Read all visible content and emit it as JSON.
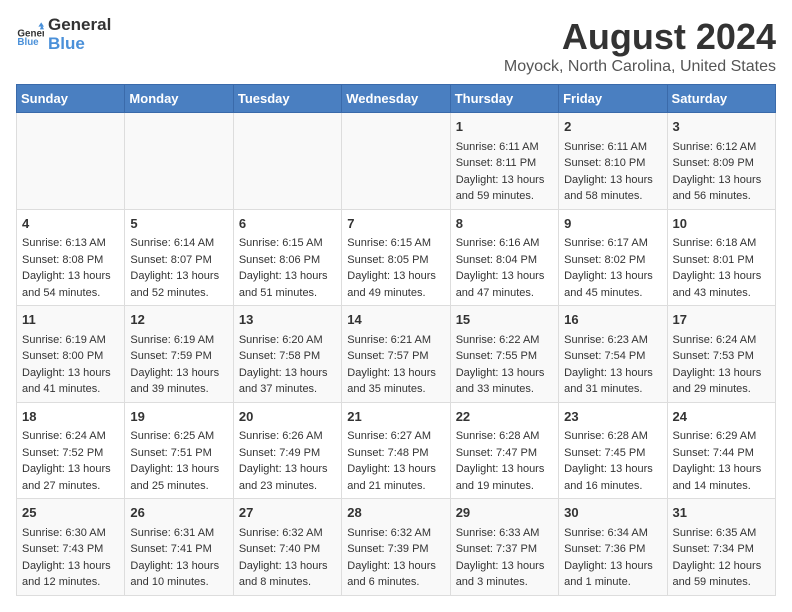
{
  "header": {
    "logo_general": "General",
    "logo_blue": "Blue",
    "main_title": "August 2024",
    "subtitle": "Moyock, North Carolina, United States"
  },
  "calendar": {
    "days_of_week": [
      "Sunday",
      "Monday",
      "Tuesday",
      "Wednesday",
      "Thursday",
      "Friday",
      "Saturday"
    ],
    "weeks": [
      [
        {
          "day": "",
          "content": ""
        },
        {
          "day": "",
          "content": ""
        },
        {
          "day": "",
          "content": ""
        },
        {
          "day": "",
          "content": ""
        },
        {
          "day": "1",
          "content": "Sunrise: 6:11 AM\nSunset: 8:11 PM\nDaylight: 13 hours\nand 59 minutes."
        },
        {
          "day": "2",
          "content": "Sunrise: 6:11 AM\nSunset: 8:10 PM\nDaylight: 13 hours\nand 58 minutes."
        },
        {
          "day": "3",
          "content": "Sunrise: 6:12 AM\nSunset: 8:09 PM\nDaylight: 13 hours\nand 56 minutes."
        }
      ],
      [
        {
          "day": "4",
          "content": "Sunrise: 6:13 AM\nSunset: 8:08 PM\nDaylight: 13 hours\nand 54 minutes."
        },
        {
          "day": "5",
          "content": "Sunrise: 6:14 AM\nSunset: 8:07 PM\nDaylight: 13 hours\nand 52 minutes."
        },
        {
          "day": "6",
          "content": "Sunrise: 6:15 AM\nSunset: 8:06 PM\nDaylight: 13 hours\nand 51 minutes."
        },
        {
          "day": "7",
          "content": "Sunrise: 6:15 AM\nSunset: 8:05 PM\nDaylight: 13 hours\nand 49 minutes."
        },
        {
          "day": "8",
          "content": "Sunrise: 6:16 AM\nSunset: 8:04 PM\nDaylight: 13 hours\nand 47 minutes."
        },
        {
          "day": "9",
          "content": "Sunrise: 6:17 AM\nSunset: 8:02 PM\nDaylight: 13 hours\nand 45 minutes."
        },
        {
          "day": "10",
          "content": "Sunrise: 6:18 AM\nSunset: 8:01 PM\nDaylight: 13 hours\nand 43 minutes."
        }
      ],
      [
        {
          "day": "11",
          "content": "Sunrise: 6:19 AM\nSunset: 8:00 PM\nDaylight: 13 hours\nand 41 minutes."
        },
        {
          "day": "12",
          "content": "Sunrise: 6:19 AM\nSunset: 7:59 PM\nDaylight: 13 hours\nand 39 minutes."
        },
        {
          "day": "13",
          "content": "Sunrise: 6:20 AM\nSunset: 7:58 PM\nDaylight: 13 hours\nand 37 minutes."
        },
        {
          "day": "14",
          "content": "Sunrise: 6:21 AM\nSunset: 7:57 PM\nDaylight: 13 hours\nand 35 minutes."
        },
        {
          "day": "15",
          "content": "Sunrise: 6:22 AM\nSunset: 7:55 PM\nDaylight: 13 hours\nand 33 minutes."
        },
        {
          "day": "16",
          "content": "Sunrise: 6:23 AM\nSunset: 7:54 PM\nDaylight: 13 hours\nand 31 minutes."
        },
        {
          "day": "17",
          "content": "Sunrise: 6:24 AM\nSunset: 7:53 PM\nDaylight: 13 hours\nand 29 minutes."
        }
      ],
      [
        {
          "day": "18",
          "content": "Sunrise: 6:24 AM\nSunset: 7:52 PM\nDaylight: 13 hours\nand 27 minutes."
        },
        {
          "day": "19",
          "content": "Sunrise: 6:25 AM\nSunset: 7:51 PM\nDaylight: 13 hours\nand 25 minutes."
        },
        {
          "day": "20",
          "content": "Sunrise: 6:26 AM\nSunset: 7:49 PM\nDaylight: 13 hours\nand 23 minutes."
        },
        {
          "day": "21",
          "content": "Sunrise: 6:27 AM\nSunset: 7:48 PM\nDaylight: 13 hours\nand 21 minutes."
        },
        {
          "day": "22",
          "content": "Sunrise: 6:28 AM\nSunset: 7:47 PM\nDaylight: 13 hours\nand 19 minutes."
        },
        {
          "day": "23",
          "content": "Sunrise: 6:28 AM\nSunset: 7:45 PM\nDaylight: 13 hours\nand 16 minutes."
        },
        {
          "day": "24",
          "content": "Sunrise: 6:29 AM\nSunset: 7:44 PM\nDaylight: 13 hours\nand 14 minutes."
        }
      ],
      [
        {
          "day": "25",
          "content": "Sunrise: 6:30 AM\nSunset: 7:43 PM\nDaylight: 13 hours\nand 12 minutes."
        },
        {
          "day": "26",
          "content": "Sunrise: 6:31 AM\nSunset: 7:41 PM\nDaylight: 13 hours\nand 10 minutes."
        },
        {
          "day": "27",
          "content": "Sunrise: 6:32 AM\nSunset: 7:40 PM\nDaylight: 13 hours\nand 8 minutes."
        },
        {
          "day": "28",
          "content": "Sunrise: 6:32 AM\nSunset: 7:39 PM\nDaylight: 13 hours\nand 6 minutes."
        },
        {
          "day": "29",
          "content": "Sunrise: 6:33 AM\nSunset: 7:37 PM\nDaylight: 13 hours\nand 3 minutes."
        },
        {
          "day": "30",
          "content": "Sunrise: 6:34 AM\nSunset: 7:36 PM\nDaylight: 13 hours\nand 1 minute."
        },
        {
          "day": "31",
          "content": "Sunrise: 6:35 AM\nSunset: 7:34 PM\nDaylight: 12 hours\nand 59 minutes."
        }
      ]
    ]
  }
}
